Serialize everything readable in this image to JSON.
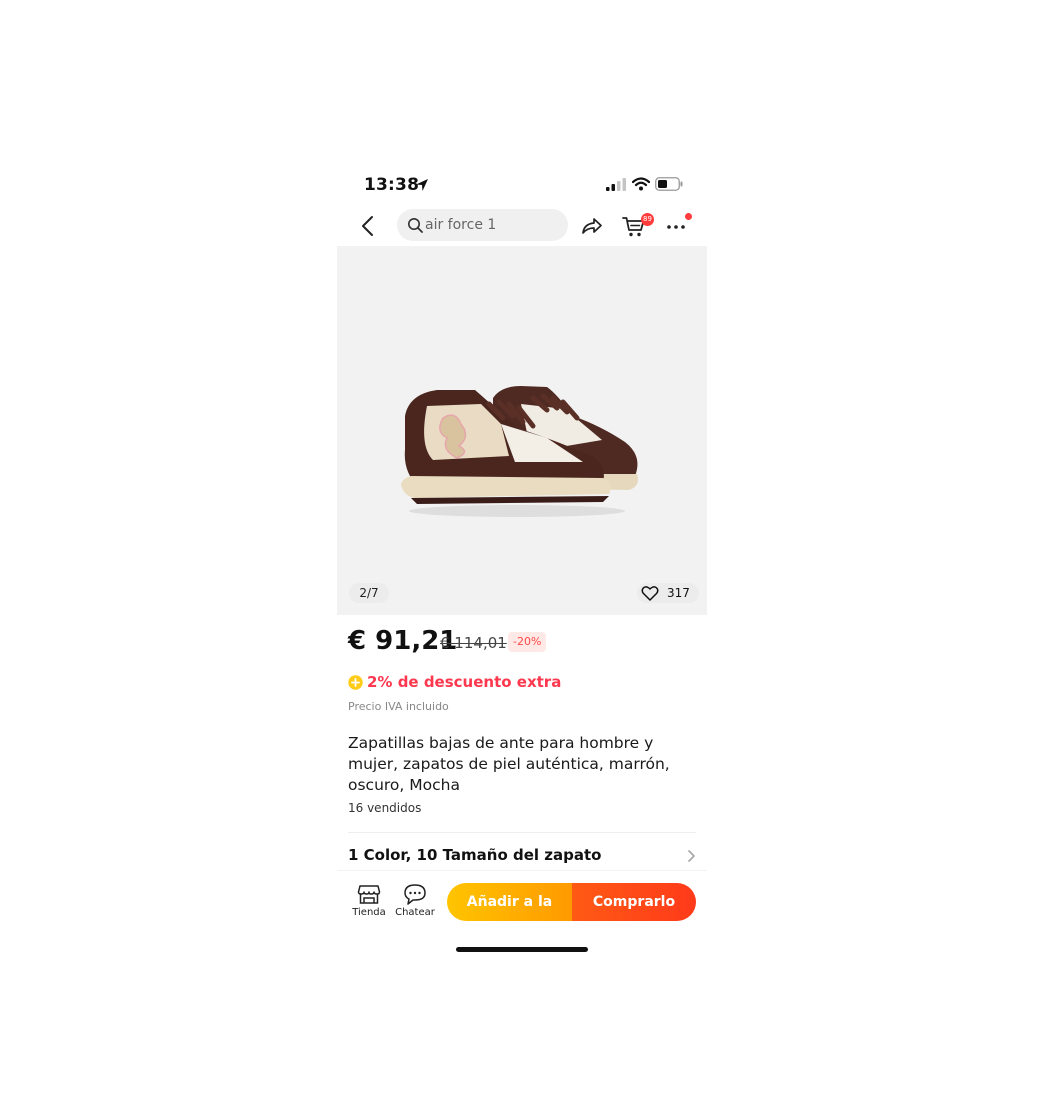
{
  "status_bar": {
    "time": "13:38"
  },
  "top_bar": {
    "search_text": "air force 1",
    "cart_badge": "89"
  },
  "gallery": {
    "page_indicator": "2/7",
    "favorites_count": "317"
  },
  "product": {
    "price": "€ 91,21",
    "original_price": "€ 114,01",
    "discount_badge": "-20%",
    "extra_discount": "2% de descuento extra",
    "vat_note": "Precio IVA incluido",
    "title": "Zapatillas bajas de ante para hombre y mujer, zapatos de piel auténtica, marrón, oscuro, Mocha",
    "sold": "16 vendidos",
    "variant_summary": "1 Color, 10 Tamaño del zapato"
  },
  "bottom_bar": {
    "store_label": "Tienda",
    "chat_label": "Chatear",
    "add_to_cart_label": "Añadir a la cesta",
    "buy_label": "Comprarlo"
  },
  "colors": {
    "accent_red": "#fd384f",
    "badge_red": "#ff3b3b",
    "add_to_cart_gradient": [
      "#ffc400",
      "#ff9a00"
    ],
    "buy_gradient": [
      "#ff5a14",
      "#ff3a1a"
    ]
  },
  "icons": [
    "location-arrow-icon",
    "signal-icon",
    "wifi-icon",
    "battery-icon",
    "back-arrow-icon",
    "search-icon",
    "share-icon",
    "cart-icon",
    "more-dots-icon",
    "heart-icon",
    "coin-plus-icon",
    "chevron-right-icon",
    "store-icon",
    "chat-bubble-icon"
  ]
}
